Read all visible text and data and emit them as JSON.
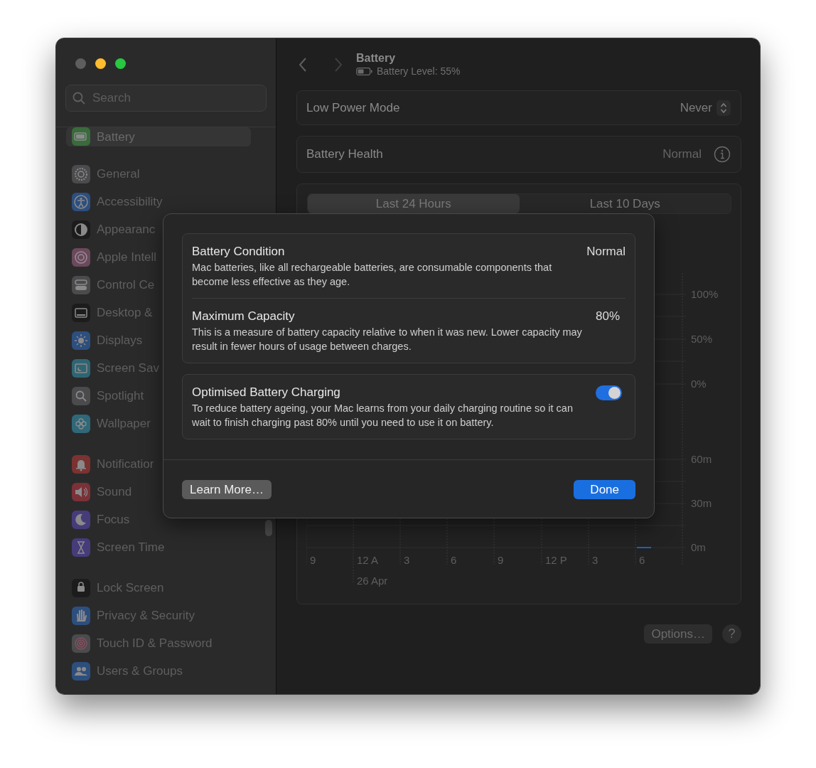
{
  "sidebar": {
    "search": {
      "placeholder": "Search"
    },
    "groups": [
      {
        "items": [
          {
            "label": "Battery",
            "selected": true,
            "color": "#3a6b3c"
          }
        ]
      },
      {
        "items": [
          {
            "label": "General",
            "selected": false,
            "color": "#4b4b4d"
          },
          {
            "label": "Accessibility",
            "selected": false,
            "color": "#2d4f7e"
          },
          {
            "label": "Appearanc",
            "selected": false,
            "color": "#1c1c1d"
          },
          {
            "label": "Apple Intell",
            "selected": false,
            "color": "#6a4a5a"
          },
          {
            "label": "Control Ce",
            "selected": false,
            "color": "#4b4b4d"
          },
          {
            "label": "Desktop &",
            "selected": false,
            "color": "#1c1c1d"
          },
          {
            "label": "Displays",
            "selected": false,
            "color": "#2d4f7e"
          },
          {
            "label": "Screen Sav",
            "selected": false,
            "color": "#2f6573"
          },
          {
            "label": "Spotlight",
            "selected": false,
            "color": "#4b4b4d"
          },
          {
            "label": "Wallpaper",
            "selected": false,
            "color": "#2f6878"
          }
        ]
      },
      {
        "items": [
          {
            "label": "Notificatior",
            "selected": false,
            "color": "#7a3331"
          },
          {
            "label": "Sound",
            "selected": false,
            "color": "#7a3137"
          },
          {
            "label": "Focus",
            "selected": false,
            "color": "#463c7a"
          },
          {
            "label": "Screen Time",
            "selected": false,
            "color": "#463c7a"
          }
        ]
      },
      {
        "items": [
          {
            "label": "Lock Screen",
            "selected": false,
            "color": "#1c1c1d"
          },
          {
            "label": "Privacy & Security",
            "selected": false,
            "color": "#2d4f7e"
          },
          {
            "label": "Touch ID & Password",
            "selected": false,
            "color": "#4b4b4d"
          },
          {
            "label": "Users & Groups",
            "selected": false,
            "color": "#2d4f7e"
          }
        ]
      }
    ]
  },
  "header": {
    "title": "Battery",
    "subtitle": "Battery Level: 55%"
  },
  "settings": [
    {
      "label": "Low Power Mode",
      "value": "Never",
      "kind": "popup"
    },
    {
      "label": "Battery Health",
      "value": "Normal",
      "kind": "info"
    }
  ],
  "usage": {
    "tabs": [
      {
        "label": "Last 24 Hours",
        "selected": true
      },
      {
        "label": "Last 10 Days",
        "selected": false
      }
    ],
    "level_axis": [
      "100%",
      "50%",
      "0%"
    ],
    "time_axis": [
      "60m",
      "30m",
      "0m"
    ],
    "hours": [
      "9",
      "12 A",
      "3",
      "6",
      "9",
      "12 P",
      "3",
      "6"
    ],
    "date": "26 Apr"
  },
  "footer_buttons": [
    {
      "label": "Options…",
      "kind": "text"
    },
    {
      "label": "?",
      "kind": "help"
    }
  ],
  "dialog": {
    "sections": [
      {
        "items": [
          {
            "kind": "value",
            "title": "Battery Condition",
            "value": "Normal",
            "description": "Mac batteries, like all rechargeable batteries, are consumable components that become less effective as they age."
          },
          {
            "kind": "value",
            "title": "Maximum Capacity",
            "value": "80%",
            "description": "This is a measure of battery capacity relative to when it was new. Lower capacity may result in fewer hours of usage between charges."
          }
        ]
      },
      {
        "items": [
          {
            "kind": "switch",
            "title": "Optimised Battery Charging",
            "on": true,
            "description": "To reduce battery ageing, your Mac learns from your daily charging routine so it can wait to finish charging past 80% until you need to use it on battery."
          }
        ]
      }
    ],
    "buttons": [
      {
        "label": "Learn More…",
        "kind": "secondary"
      },
      {
        "label": "Done",
        "kind": "primary"
      }
    ]
  }
}
